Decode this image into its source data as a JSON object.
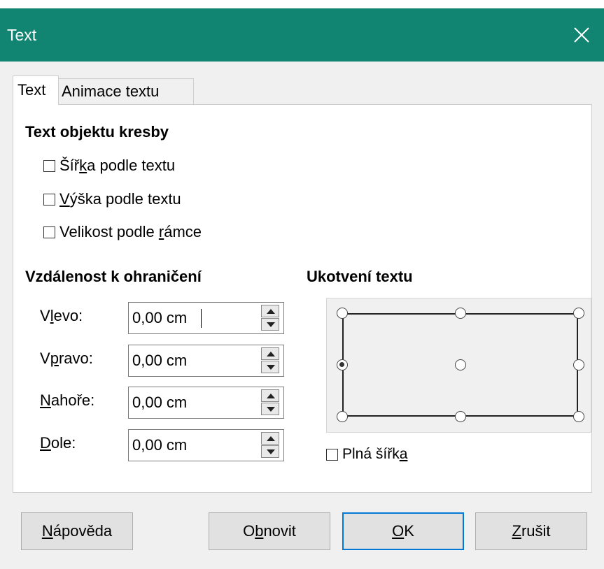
{
  "dialog": {
    "title": "Text",
    "close_icon": "close-icon"
  },
  "tabs": [
    {
      "label": "Text",
      "active": true
    },
    {
      "label": "Animace textu",
      "active": false
    }
  ],
  "drawing_text": {
    "heading": "Text objektu kresby",
    "options": [
      {
        "pre": "Šíř",
        "key": "k",
        "post": "a podle textu",
        "checked": false
      },
      {
        "pre": "",
        "key": "V",
        "post": "ýška podle textu",
        "checked": false
      },
      {
        "pre": "Velikost podle ",
        "key": "r",
        "post": "ámce",
        "checked": false
      }
    ]
  },
  "spacing": {
    "heading": "Vzdálenost k ohraničení",
    "fields": [
      {
        "pre": "V",
        "key": "l",
        "post": "evo:",
        "value": "0,00 cm"
      },
      {
        "pre": "V",
        "key": "p",
        "post": "ravo:",
        "value": "0,00 cm"
      },
      {
        "pre": "",
        "key": "N",
        "post": "ahoře:",
        "value": "0,00 cm"
      },
      {
        "pre": "",
        "key": "D",
        "post": "ole:",
        "value": "0,00 cm"
      }
    ]
  },
  "anchor": {
    "heading": "Ukotvení textu",
    "selected": "middle-left",
    "full_width": {
      "pre": "Plná šířk",
      "key": "a",
      "post": "",
      "checked": false
    }
  },
  "buttons": {
    "help": {
      "pre": "",
      "key": "N",
      "post": "ápověda"
    },
    "reset": {
      "pre": "O",
      "key": "b",
      "post": "novit"
    },
    "ok": {
      "pre": "",
      "key": "O",
      "post": "K"
    },
    "cancel": {
      "pre": "",
      "key": "Z",
      "post": "rušit"
    }
  },
  "colors": {
    "titlebar": "#118572",
    "default_button_border": "#0078d7"
  }
}
